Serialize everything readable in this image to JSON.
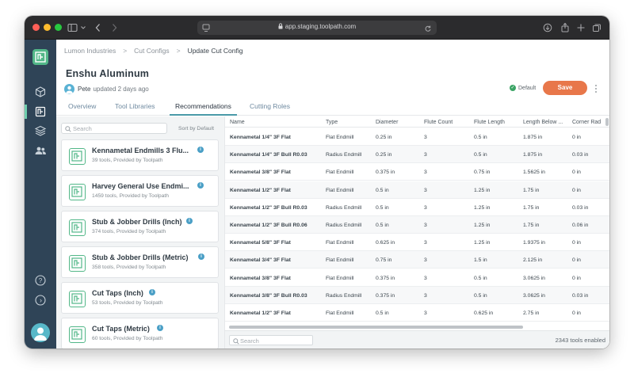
{
  "browser": {
    "url": "app.staging.toolpath.com",
    "colors": {
      "close": "#ff5f57",
      "minimize": "#febc2e",
      "zoom": "#28c840"
    }
  },
  "sidebar": {
    "icons": [
      "logo-icon",
      "cube-icon",
      "config-icon",
      "layers-icon",
      "users-icon",
      "help-icon",
      "expand-icon",
      "user-avatar"
    ],
    "help_glyph": "?",
    "expand_glyph": "›"
  },
  "breadcrumb": {
    "items": [
      "Lumon Industries",
      "Cut Configs",
      "Update Cut Config"
    ],
    "separator": ">"
  },
  "header": {
    "title": "Enshu Aluminum",
    "user": "Pete",
    "updated_text": "updated 2 days ago",
    "default_label": "Default",
    "save_label": "Save",
    "accent": "#e8774a"
  },
  "tabs": [
    {
      "label": "Overview"
    },
    {
      "label": "Tool Libraries"
    },
    {
      "label": "Recommendations"
    },
    {
      "label": "Cutting Roles"
    }
  ],
  "active_tab": "Recommendations",
  "libraries": {
    "search_placeholder": "Search",
    "sort_label": "Sort by Default",
    "items": [
      {
        "name": "Kennametal Endmills 3 Flu...",
        "sub": "39 tools, Provided by Toolpath"
      },
      {
        "name": "Harvey General Use Endmi...",
        "sub": "1459 tools, Provided by Toolpath"
      },
      {
        "name": "Stub & Jobber Drills (Inch)",
        "sub": "374 tools, Provided by Toolpath"
      },
      {
        "name": "Stub & Jobber Drills (Metric)",
        "sub": "358 tools, Provided by Toolpath"
      },
      {
        "name": "Cut Taps (Inch)",
        "sub": "53 tools, Provided by Toolpath"
      },
      {
        "name": "Cut Taps (Metric)",
        "sub": "60 tools, Provided by Toolpath"
      }
    ]
  },
  "table": {
    "columns": [
      "Name",
      "Type",
      "Diameter",
      "Flute Count",
      "Flute Length",
      "Length Below ...",
      "Corner Rad"
    ],
    "rows": [
      [
        "Kennametal 1/4\" 3F Flat",
        "Flat Endmill",
        "0.25 in",
        "3",
        "0.5 in",
        "1.875 in",
        "0 in"
      ],
      [
        "Kennametal 1/4\" 3F Bull R0.03",
        "Radius Endmill",
        "0.25 in",
        "3",
        "0.5 in",
        "1.875 in",
        "0.03 in"
      ],
      [
        "Kennametal 3/8\" 3F Flat",
        "Flat Endmill",
        "0.375 in",
        "3",
        "0.75 in",
        "1.5625 in",
        "0 in"
      ],
      [
        "Kennametal 1/2\" 3F Flat",
        "Flat Endmill",
        "0.5 in",
        "3",
        "1.25 in",
        "1.75 in",
        "0 in"
      ],
      [
        "Kennametal 1/2\" 3F Bull R0.03",
        "Radius Endmill",
        "0.5 in",
        "3",
        "1.25 in",
        "1.75 in",
        "0.03 in"
      ],
      [
        "Kennametal 1/2\" 3F Bull R0.06",
        "Radius Endmill",
        "0.5 in",
        "3",
        "1.25 in",
        "1.75 in",
        "0.06 in"
      ],
      [
        "Kennametal 5/8\" 3F Flat",
        "Flat Endmill",
        "0.625 in",
        "3",
        "1.25 in",
        "1.9375 in",
        "0 in"
      ],
      [
        "Kennametal 3/4\" 3F Flat",
        "Flat Endmill",
        "0.75 in",
        "3",
        "1.5 in",
        "2.125 in",
        "0 in"
      ],
      [
        "Kennametal 3/8\" 3F Flat",
        "Flat Endmill",
        "0.375 in",
        "3",
        "0.5 in",
        "3.0625 in",
        "0 in"
      ],
      [
        "Kennametal 3/8\" 3F Bull R0.03",
        "Radius Endmill",
        "0.375 in",
        "3",
        "0.5 in",
        "3.0625 in",
        "0.03 in"
      ],
      [
        "Kennametal 1/2\" 3F Flat",
        "Flat Endmill",
        "0.5 in",
        "3",
        "0.625 in",
        "2.75 in",
        "0 in"
      ]
    ]
  },
  "footer": {
    "search_placeholder": "Search",
    "enabled_text": "2343 tools enabled"
  }
}
